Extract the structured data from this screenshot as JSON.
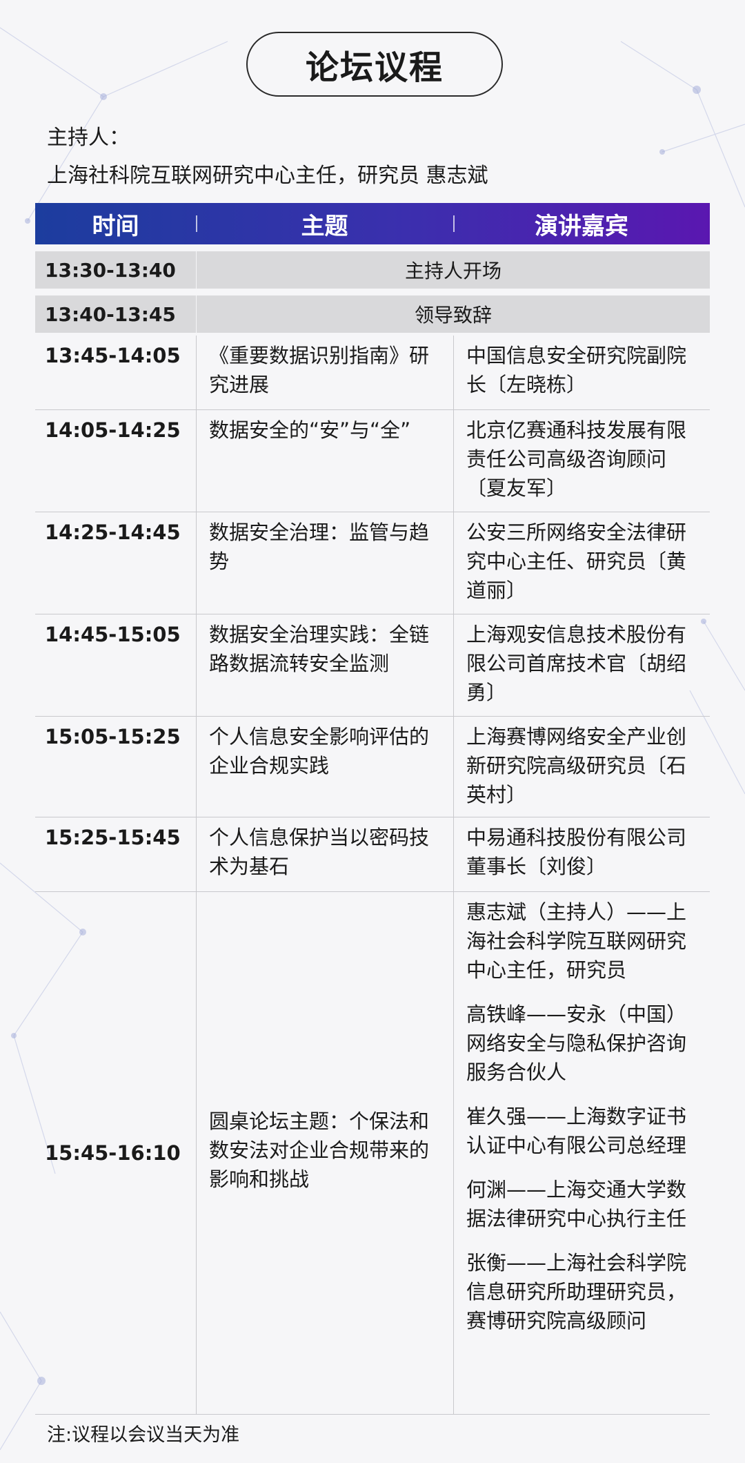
{
  "title": "论坛议程",
  "host": {
    "label": "主持人：",
    "name": "上海社科院互联网研究中心主任，研究员  惠志斌"
  },
  "table": {
    "headers": [
      "时间",
      "主题",
      "演讲嘉宾"
    ],
    "gray_rows": [
      {
        "time": "13:30-13:40",
        "text": "主持人开场"
      },
      {
        "time": "13:40-13:45",
        "text": "领导致辞"
      }
    ],
    "rows": [
      {
        "time": "13:45-14:05",
        "topic": "《重要数据识别指南》研究进展",
        "speaker": "中国信息安全研究院副院长〔左晓栋〕"
      },
      {
        "time": "14:05-14:25",
        "topic": "数据安全的“安”与“全”",
        "speaker": "北京亿赛通科技发展有限责任公司高级咨询顾问〔夏友军〕"
      },
      {
        "time": "14:25-14:45",
        "topic": "数据安全治理：监管与趋势",
        "speaker": "公安三所网络安全法律研究中心主任、研究员〔黄道丽〕"
      },
      {
        "time": "14:45-15:05",
        "topic": "数据安全治理实践：全链路数据流转安全监测",
        "speaker": "上海观安信息技术股份有限公司首席技术官〔胡绍勇〕"
      },
      {
        "time": "15:05-15:25",
        "topic": "个人信息安全影响评估的企业合规实践",
        "speaker": "上海赛博网络安全产业创新研究院高级研究员〔石英村〕"
      },
      {
        "time": "15:25-15:45",
        "topic": "个人信息保护当以密码技术为基石",
        "speaker": "中易通科技股份有限公司董事长〔刘俊〕"
      }
    ],
    "panel": {
      "time": "15:45-16:10",
      "topic": "圆桌论坛主题：个保法和数安法对企业合规带来的影响和挑战",
      "speakers": [
        "惠志斌（主持人）——上海社会科学院互联网研究中心主任，研究员",
        "高铁峰——安永（中国）网络安全与隐私保护咨询服务合伙人",
        "崔久强——上海数字证书认证中心有限公司总经理",
        "何渊——上海交通大学数据法律研究中心执行主任",
        "张衡——上海社会科学院信息研究所助理研究员，赛博研究院高级顾问"
      ]
    }
  },
  "note": "注:议程以会议当天为准",
  "colors": {
    "header_start": "#1c3d9e",
    "header_end": "#5a17b0",
    "gray_row": "#d9d9db",
    "background": "#f6f6f8"
  }
}
